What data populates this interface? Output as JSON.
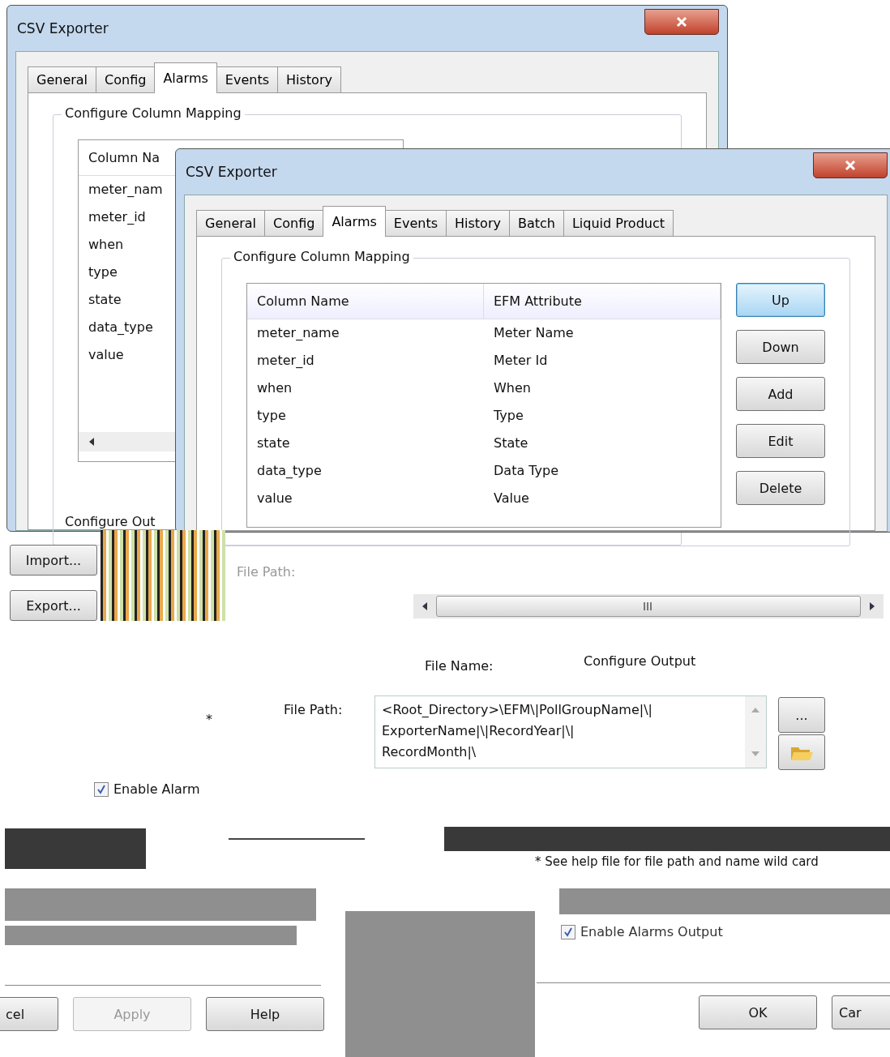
{
  "back_window": {
    "title": "CSV Exporter",
    "tabs": [
      {
        "label": "General",
        "selected": false
      },
      {
        "label": "Config",
        "selected": false
      },
      {
        "label": "Alarms",
        "selected": true
      },
      {
        "label": "Events",
        "selected": false
      },
      {
        "label": "History",
        "selected": false
      }
    ],
    "group_title": "Configure Column Mapping",
    "list": {
      "column": "Column Na",
      "rows": [
        "meter_nam",
        "meter_id",
        "when",
        "type",
        "state",
        "data_type",
        "value"
      ]
    },
    "output_group_title": "Configure Out",
    "buttons": [
      "Import...",
      "Export..."
    ]
  },
  "front_window": {
    "title": "CSV Exporter",
    "tabs": [
      {
        "label": "General",
        "selected": false
      },
      {
        "label": "Config",
        "selected": false
      },
      {
        "label": "Alarms",
        "selected": true
      },
      {
        "label": "Events",
        "selected": false
      },
      {
        "label": "History",
        "selected": false
      },
      {
        "label": "Batch",
        "selected": false
      },
      {
        "label": "Liquid Product",
        "selected": false
      }
    ],
    "group_title": "Configure Column Mapping",
    "list": {
      "columns": [
        "Column Name",
        "EFM Attribute"
      ],
      "rows": [
        [
          "meter_name",
          "Meter Name"
        ],
        [
          "meter_id",
          "Meter Id"
        ],
        [
          "when",
          "When"
        ],
        [
          "type",
          "Type"
        ],
        [
          "state",
          "State"
        ],
        [
          "data_type",
          "Data Type"
        ],
        [
          "value",
          "Value"
        ]
      ]
    },
    "buttons": [
      {
        "label": "Up",
        "default": true
      },
      {
        "label": "Down",
        "default": false
      },
      {
        "label": "Add",
        "default": false
      },
      {
        "label": "Edit",
        "default": false
      },
      {
        "label": "Delete",
        "default": false
      }
    ]
  },
  "output": {
    "faded_file_path_label": "File Path:",
    "file_name_label": "File Name:",
    "group_title": "Configure Output",
    "file_path_label": "File Path:",
    "file_path_lines": [
      "<Root_Directory>\\EFM\\|PollGroupName|\\|",
      "ExporterName|\\|RecordYear|\\|",
      "RecordMonth|\\"
    ],
    "browse_button": "...",
    "asterisk": "*",
    "enable_checkbox": {
      "label": "Enable Alarm",
      "checked": true
    },
    "help_note": "* See help file for file path and name wild card",
    "enable_output": {
      "label": "Enable Alarms Output",
      "checked": true
    }
  },
  "footer_left": [
    {
      "label": "cel",
      "disabled": false
    },
    {
      "label": "Apply",
      "disabled": true
    },
    {
      "label": "Help",
      "disabled": false
    }
  ],
  "footer_right": [
    {
      "label": "OK",
      "disabled": false
    },
    {
      "label": "Car",
      "disabled": false
    }
  ]
}
